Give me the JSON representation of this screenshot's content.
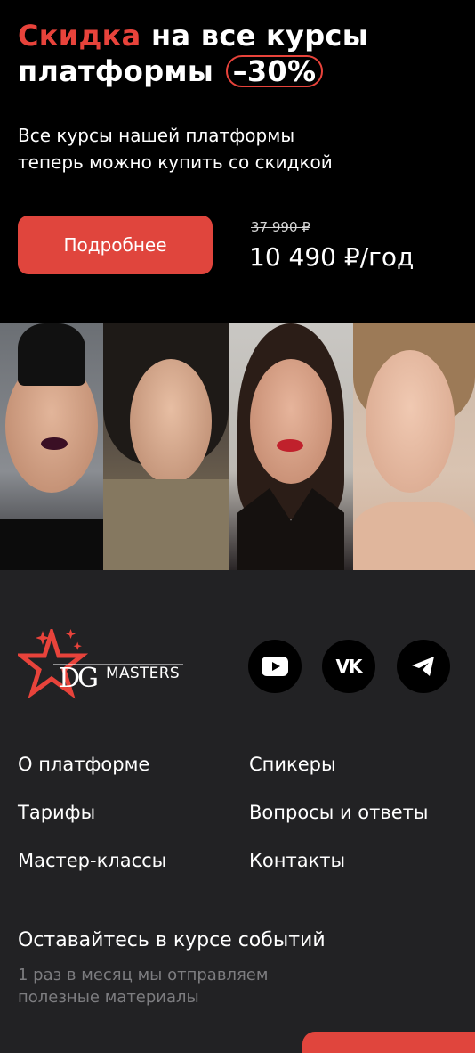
{
  "promo": {
    "title_accent": "Скидка",
    "title_rest": " на все курсы платформы ",
    "discount": "–30%",
    "subtitle": "Все курсы нашей платформы\nтеперь можно купить со скидкой",
    "button_label": "Подробнее",
    "old_price": "37 990 ₽",
    "new_price": "10 490 ₽/год"
  },
  "footer": {
    "logo_text": "MASTERS",
    "logo_letters": "DG",
    "social": [
      "youtube-icon",
      "vk-icon",
      "telegram-icon"
    ],
    "vk_glyph": "VK",
    "nav_left": [
      "О платформе",
      "Тарифы",
      "Мастер-классы"
    ],
    "nav_right": [
      "Спикеры",
      "Вопросы и ответы",
      "Контакты"
    ],
    "subscribe_title": "Оставайтесь в курсе событий",
    "subscribe_sub": "1 раз в месяц мы отправляем\nполезные материалы"
  },
  "colors": {
    "accent": "#e8433b",
    "button": "#e0453d",
    "footer_bg": "#222224"
  }
}
